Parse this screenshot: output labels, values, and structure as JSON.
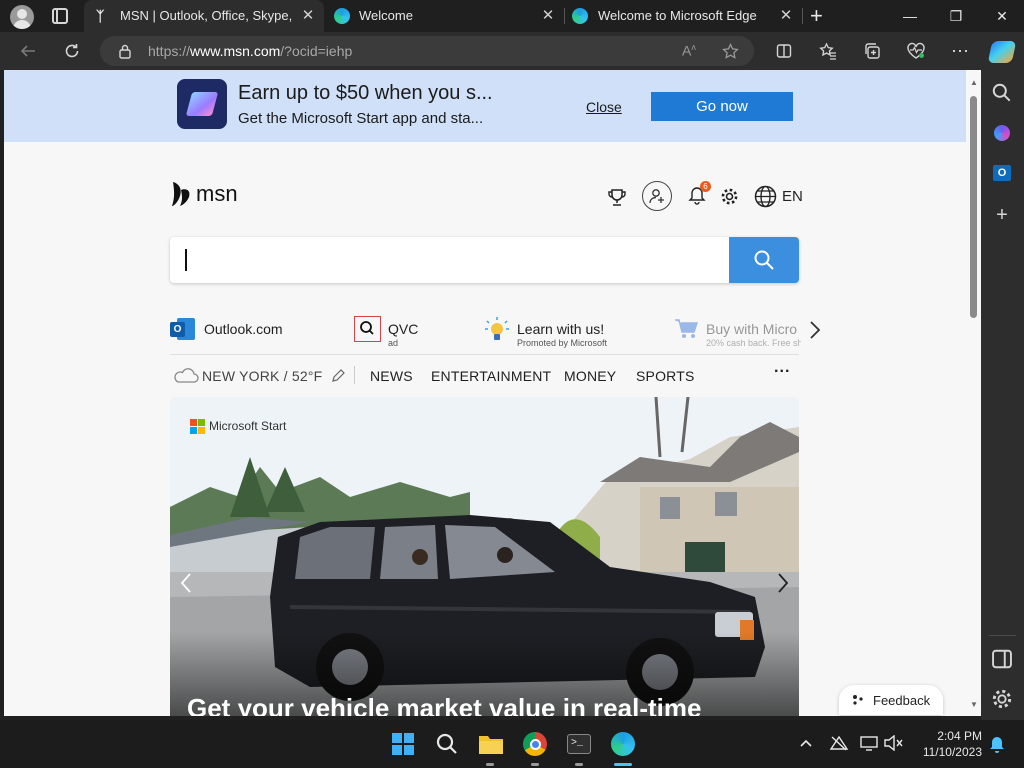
{
  "browser": {
    "tabs": [
      {
        "title": "MSN | Outlook, Office, Skype, Bing, Breaking News, and Latest Videos",
        "active": true
      },
      {
        "title": "Welcome",
        "active": false
      },
      {
        "title": "Welcome to Microsoft Edge",
        "active": false
      }
    ],
    "new_tab_symbol": "+",
    "close_symbol": "✕",
    "window_controls": {
      "minimize": "—",
      "maximize": "❐",
      "close": "✕"
    },
    "url_prefix": "https://",
    "url_host": "www.msn.com",
    "url_path": "/?ocid=iehp",
    "more_symbol": "⋯"
  },
  "banner": {
    "headline": "Earn up to $50 when you s...",
    "subline": "Get the Microsoft Start app and sta...",
    "close_label": "Close",
    "cta_label": "Go now"
  },
  "header": {
    "logo_text": "msn",
    "notification_count": "6",
    "language": "EN"
  },
  "search": {
    "value": "",
    "placeholder": ""
  },
  "quick_links": [
    {
      "label": "Outlook.com",
      "sublabel": ""
    },
    {
      "label": "QVC",
      "sublabel": "ad"
    },
    {
      "label": "Learn with us!",
      "sublabel": "Promoted by Microsoft"
    },
    {
      "label": "Buy with Micro",
      "sublabel": "20% cash back. Free sh"
    }
  ],
  "nav": {
    "weather": "NEW YORK / 52°F",
    "items": [
      "NEWS",
      "ENTERTAINMENT",
      "MONEY",
      "SPORTS"
    ],
    "more": "···"
  },
  "hero": {
    "brand": "Microsoft Start",
    "headline": "Get your vehicle market value in real-time"
  },
  "feedback_label": "Feedback",
  "taskbar": {
    "time": "2:04 PM",
    "date": "11/10/2023"
  },
  "colors": {
    "accent": "#1f7ad6",
    "search_button": "#3b8fde",
    "banner_bg": "#cfe0f8",
    "notification_badge": "#e65d1f"
  }
}
